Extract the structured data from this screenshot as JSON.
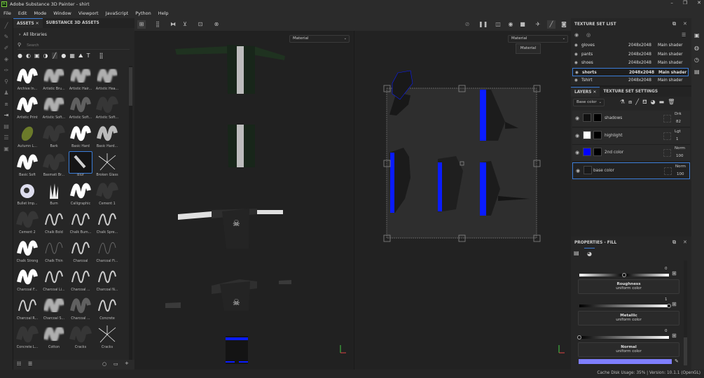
{
  "app": {
    "title": "Adobe Substance 3D Painter - shirt",
    "logo": "Pt",
    "controls": [
      "–",
      "❐",
      "✕"
    ]
  },
  "menu": [
    "File",
    "Edit",
    "Mode",
    "Window",
    "Viewport",
    "JavaScript",
    "Python",
    "Help"
  ],
  "assets": {
    "tabs": [
      "ASSETS",
      "SUBSTANCE 3D ASSETS"
    ],
    "library": "All libraries",
    "search_placeholder": "Search",
    "brushes": [
      {
        "label": "Archive In...",
        "style": "solid"
      },
      {
        "label": "Artistic Bru...",
        "style": "soft"
      },
      {
        "label": "Artistic Hair...",
        "style": "soft"
      },
      {
        "label": "Artistic Hea...",
        "style": "soft"
      },
      {
        "label": "Artistic Print",
        "style": "solid"
      },
      {
        "label": "Artistic Soft...",
        "style": "soft"
      },
      {
        "label": "Artistic Soft...",
        "style": "faint"
      },
      {
        "label": "Artistic Soft...",
        "style": "dark"
      },
      {
        "label": "Autumn L...",
        "style": "leaf"
      },
      {
        "label": "Bark",
        "style": "dark"
      },
      {
        "label": "Basic Hard",
        "style": "solid"
      },
      {
        "label": "Basic Hard...",
        "style": "gradient"
      },
      {
        "label": "Basic Soft",
        "style": "solid"
      },
      {
        "label": "Basmati Br...",
        "style": "dark"
      },
      {
        "label": "Blur",
        "style": "blur",
        "selected": true
      },
      {
        "label": "Broken Glass",
        "style": "glass"
      },
      {
        "label": "Bullet Imp...",
        "style": "splat"
      },
      {
        "label": "Burn",
        "style": "burn"
      },
      {
        "label": "Calligraphic",
        "style": "solid"
      },
      {
        "label": "Cement 1",
        "style": "dark"
      },
      {
        "label": "Cement 2",
        "style": "dark"
      },
      {
        "label": "Chalk Bold",
        "style": "line"
      },
      {
        "label": "Chalk Bum...",
        "style": "line"
      },
      {
        "label": "Chalk Spre...",
        "style": "line"
      },
      {
        "label": "Chalk Strong",
        "style": "solid"
      },
      {
        "label": "Chalk Thin",
        "style": "thinline"
      },
      {
        "label": "Charcoal",
        "style": "line"
      },
      {
        "label": "Charcoal Fi...",
        "style": "thinline"
      },
      {
        "label": "Charcoal F...",
        "style": "solid"
      },
      {
        "label": "Charcoal Li...",
        "style": "line"
      },
      {
        "label": "Charcoal ...",
        "style": "line"
      },
      {
        "label": "Charcoal N...",
        "style": "line"
      },
      {
        "label": "Charcoal R...",
        "style": "line"
      },
      {
        "label": "Charcoal S...",
        "style": "soft"
      },
      {
        "label": "Charcoal ...",
        "style": "faint"
      },
      {
        "label": "Concrete",
        "style": "line"
      },
      {
        "label": "Concrete L...",
        "style": "dark"
      },
      {
        "label": "Cotton",
        "style": "soft"
      },
      {
        "label": "Cracks",
        "style": "dark"
      },
      {
        "label": "Cracks",
        "style": "glass"
      }
    ]
  },
  "viewport": {
    "material_left": "Material",
    "material_right": "Material",
    "tooltip": "Material"
  },
  "texture_set_list": {
    "title": "TEXTURE SET LIST",
    "rows": [
      {
        "name": "gloves",
        "size": "2048x2048",
        "shader": "Main shader"
      },
      {
        "name": "pants",
        "size": "2048x2048",
        "shader": "Main shader"
      },
      {
        "name": "shoes",
        "size": "2048x2048",
        "shader": "Main shader"
      },
      {
        "name": "shorts",
        "size": "2048x2048",
        "shader": "Main shader",
        "selected": true
      },
      {
        "name": "Tshirt",
        "size": "2048x2048",
        "shader": "Main shader"
      }
    ]
  },
  "layers": {
    "tabs": [
      "LAYERS",
      "TEXTURE SET SETTINGS"
    ],
    "channel": "Base color",
    "items": [
      {
        "name": "shadows",
        "blend": "Drk",
        "opacity": "82",
        "color": "#111111"
      },
      {
        "name": "highlight",
        "blend": "Lgt",
        "opacity": "1",
        "color": "#ffffff"
      },
      {
        "name": "2nd color",
        "blend": "Norm",
        "opacity": "100",
        "color": "#0000ff"
      },
      {
        "name": "base color",
        "blend": "Norm",
        "opacity": "100",
        "color": "#1a1a1a",
        "selected": true
      }
    ]
  },
  "properties": {
    "title": "PROPERTIES - FILL",
    "channels": [
      {
        "value": "0",
        "level": 0.5
      },
      {
        "name": "Roughness",
        "source": "uniform color",
        "value": "1",
        "level": 1
      },
      {
        "name": "Metallic",
        "source": "uniform color",
        "value": "0",
        "level": 0
      },
      {
        "name": "Normal",
        "source": "uniform color"
      }
    ],
    "normal_color": "#7f7fff"
  },
  "status": {
    "text": "Cache Disk Usage:   35% | Version: 10.1.1 (OpenGL)"
  },
  "colors": {
    "accent": "#3b7dd8",
    "uv_blue": "#0a1cff",
    "shirt_green": "#1f3220"
  }
}
